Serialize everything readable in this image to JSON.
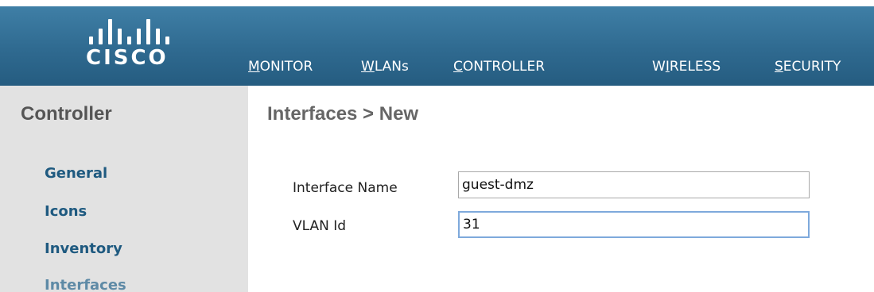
{
  "logo": {
    "text": "CISCO",
    "icon": "cisco-bars-logo"
  },
  "nav": [
    {
      "first": "M",
      "rest": "ONITOR"
    },
    {
      "first": "W",
      "rest": "LANs"
    },
    {
      "first": "C",
      "rest": "ONTROLLER"
    },
    {
      "pre": "W",
      "first": "I",
      "rest": "RELESS"
    },
    {
      "first": "S",
      "rest": "ECURITY"
    }
  ],
  "sidebar": {
    "title": "Controller",
    "items": [
      "General",
      "Icons",
      "Inventory",
      "Interfaces"
    ]
  },
  "page": {
    "title": "Interfaces > New"
  },
  "form": {
    "interface_name_label": "Interface Name",
    "interface_name_value": "guest-dmz",
    "vlan_label": "VLAN Id",
    "vlan_value": "31"
  },
  "colors": {
    "header": "#2f6a90",
    "sidebar_bg": "#e2e2e2",
    "link": "#1f5a80",
    "focus": "#7ea9dc"
  }
}
